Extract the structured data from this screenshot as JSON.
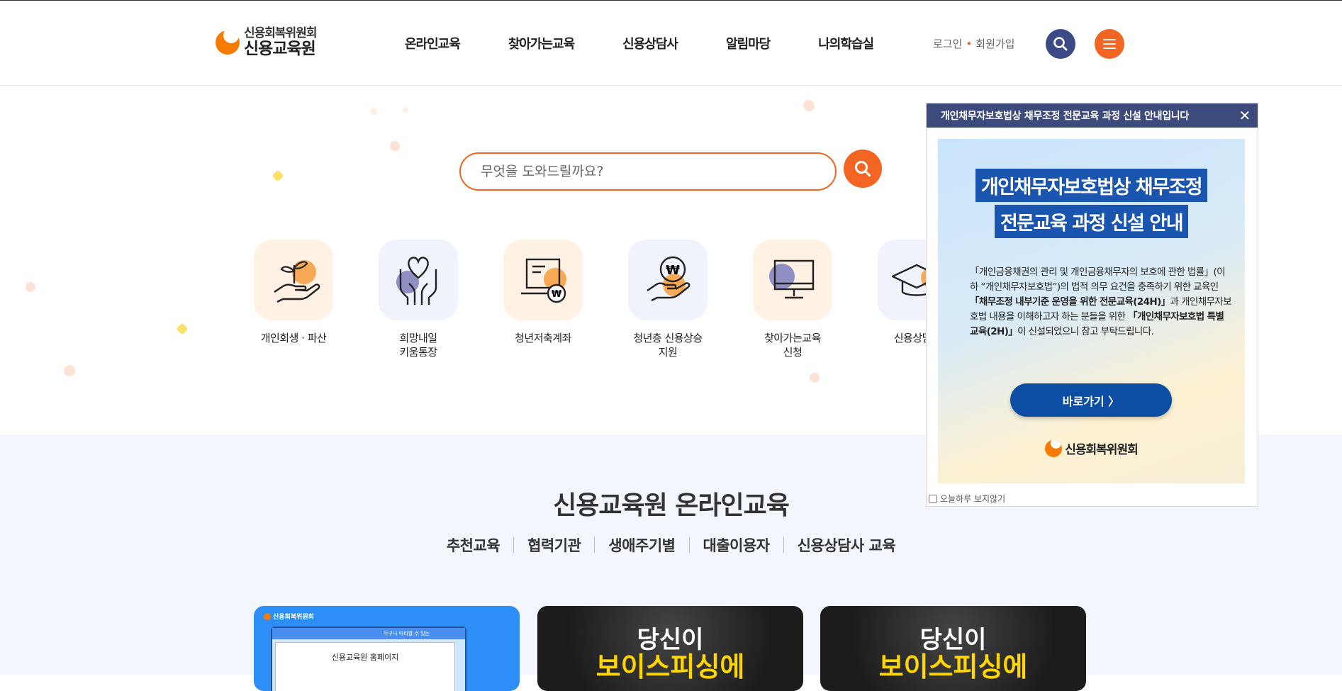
{
  "header": {
    "logo_sub": "신용회복위원회",
    "logo_main": "신용교육원",
    "nav": [
      "온라인교육",
      "찾아가는교육",
      "신용상담사",
      "알림마당",
      "나의학습실"
    ],
    "login": "로그인",
    "signup": "회원가입"
  },
  "search": {
    "placeholder": "무엇을 도와드릴까요?"
  },
  "quick_menu": [
    {
      "label": "개인회생 · 파산",
      "icon": "hand-plant-icon"
    },
    {
      "label": "희망내일\n키움통장",
      "icon": "hands-heart-icon"
    },
    {
      "label": "청년저축계좌",
      "icon": "laptop-won-icon"
    },
    {
      "label": "청년층 신용상승\n지원",
      "icon": "hand-won-coin-icon"
    },
    {
      "label": "찾아가는교육\n신청",
      "icon": "monitor-icon"
    },
    {
      "label": "신용상담사",
      "icon": "graduation-cap-icon"
    }
  ],
  "online": {
    "title": "신용교육원 온라인교육",
    "tabs": [
      "추천교육",
      "협력기관",
      "생애주기별",
      "대출이용자",
      "신용상담사 교육"
    ],
    "active_tab": "추천교육"
  },
  "cards": [
    {
      "brand": "신용회복위원회",
      "window_text": "누구나 따라할 수 있는",
      "inner_title": "신용교육원 홈페이지"
    },
    {
      "headline1": "당신이",
      "headline2": "보이스피싱에"
    },
    {
      "headline1": "당신이",
      "headline2": "보이스피싱에"
    }
  ],
  "popup": {
    "header": "개인채무자보호법상 채무조정 전문교육 과정 신설 안내입니다",
    "close": "X",
    "title_line1": "개인채무자보호법상 채무조정",
    "title_line2": "전문교육 과정 신설 안내",
    "desc_1": "「개인금융채권의 관리 및 개인금융채무자의 보호에 관한 법률」(이하 “개인채무자보호법”)의 법적 의무 요건을 충족하기 위한 교육인 ",
    "desc_b1": "「채무조정 내부기준 운영을 위한 전문교육(24H)」",
    "desc_2": "과 개인채무자보호법 내용을 이해하고자 하는 분들을 위한 ",
    "desc_b2": "「개인채무자보호법 특별교육(2H)」",
    "desc_3": "이 신설되었으니 참고 부탁드립니다.",
    "button": "바로가기 〉",
    "logo": "신용회복위원회",
    "dismiss": "오늘하루 보지않기"
  },
  "colors": {
    "accent": "#f26522",
    "navy": "#3b4a86",
    "popup_blue": "#1a56b0"
  }
}
